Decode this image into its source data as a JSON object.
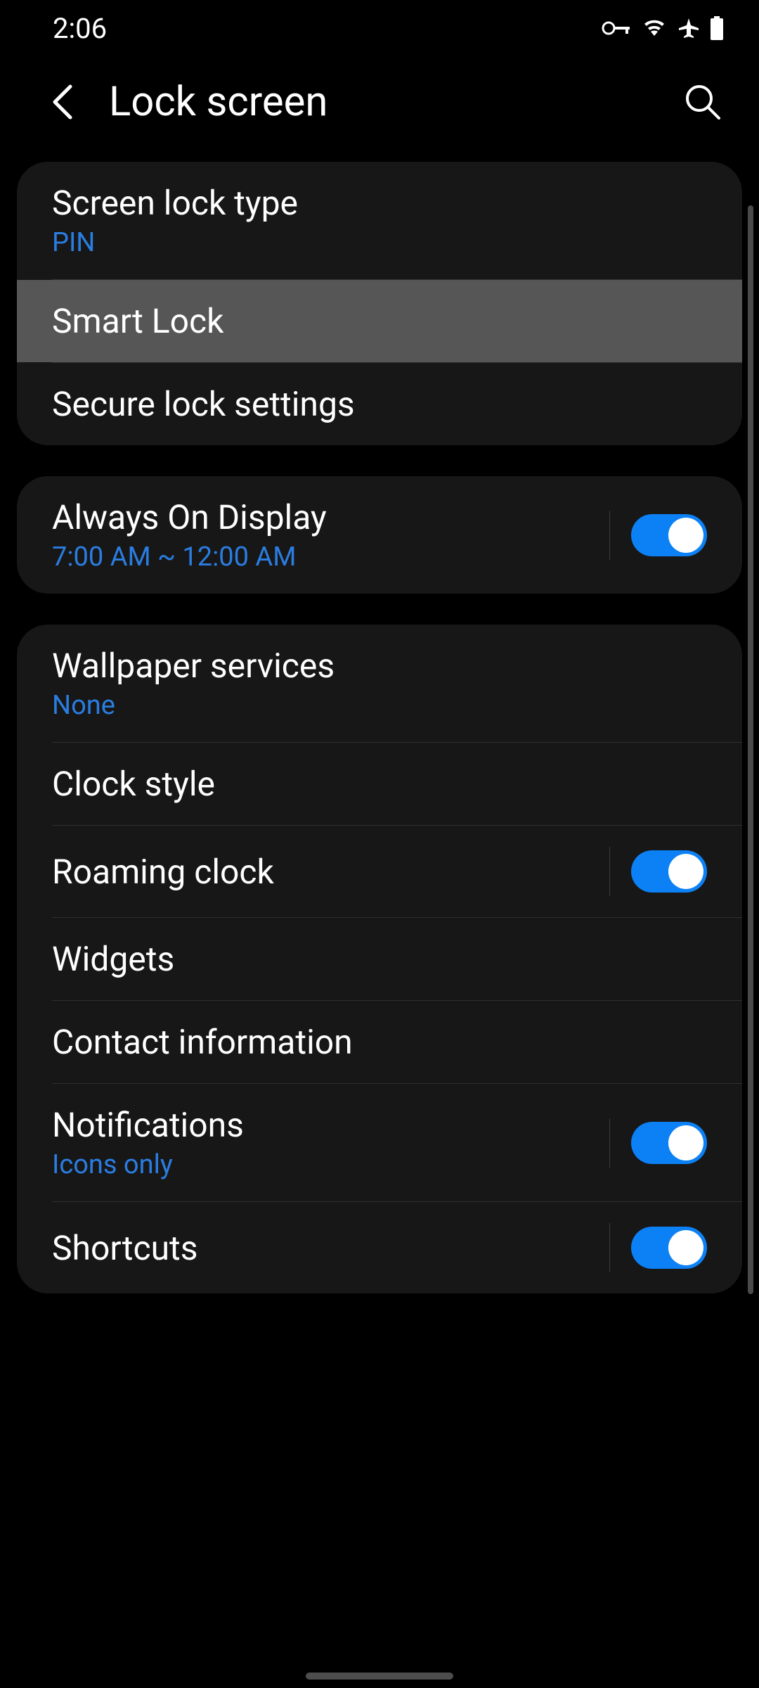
{
  "status": {
    "time": "2:06"
  },
  "header": {
    "title": "Lock screen"
  },
  "groups": [
    {
      "items": [
        {
          "title": "Screen lock type",
          "sub": "PIN",
          "toggle": null,
          "highlighted": false
        },
        {
          "title": "Smart Lock",
          "sub": null,
          "toggle": null,
          "highlighted": true
        },
        {
          "title": "Secure lock settings",
          "sub": null,
          "toggle": null,
          "highlighted": false
        }
      ]
    },
    {
      "items": [
        {
          "title": "Always On Display",
          "sub": "7:00 AM ~ 12:00 AM",
          "toggle": true,
          "highlighted": false
        }
      ]
    },
    {
      "items": [
        {
          "title": "Wallpaper services",
          "sub": "None",
          "toggle": null,
          "highlighted": false
        },
        {
          "title": "Clock style",
          "sub": null,
          "toggle": null,
          "highlighted": false
        },
        {
          "title": "Roaming clock",
          "sub": null,
          "toggle": true,
          "highlighted": false
        },
        {
          "title": "Widgets",
          "sub": null,
          "toggle": null,
          "highlighted": false
        },
        {
          "title": "Contact information",
          "sub": null,
          "toggle": null,
          "highlighted": false
        },
        {
          "title": "Notifications",
          "sub": "Icons only",
          "toggle": true,
          "highlighted": false
        },
        {
          "title": "Shortcuts",
          "sub": null,
          "toggle": true,
          "highlighted": false
        }
      ]
    }
  ]
}
